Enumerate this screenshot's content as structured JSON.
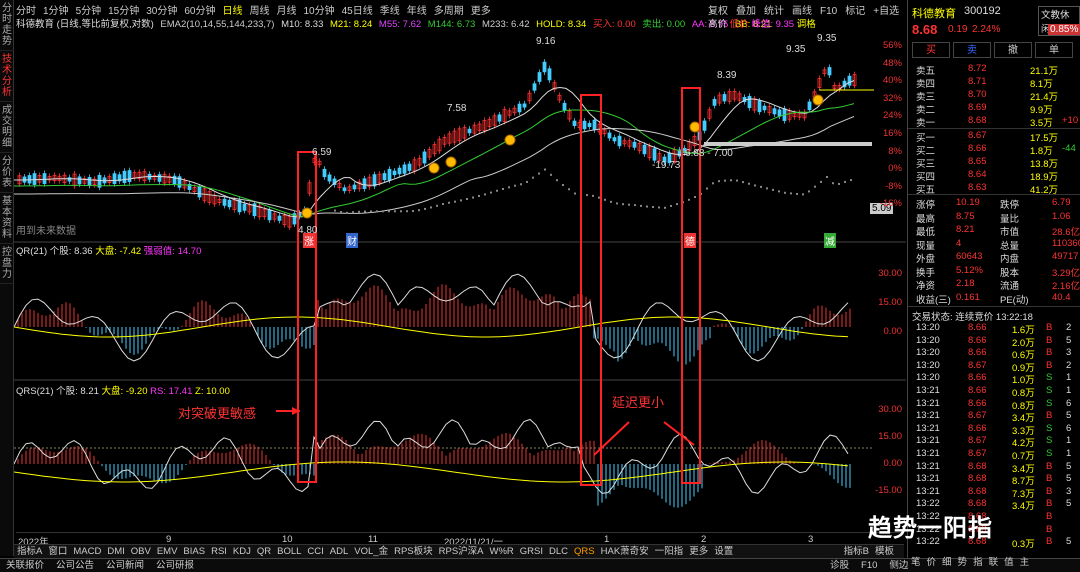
{
  "side_tabs": [
    "分时走势",
    "技术分析",
    "成交明细",
    "分价表",
    "基本资料",
    "控盘力"
  ],
  "side_tabs_active": 1,
  "periods": [
    "分时",
    "1分钟",
    "5分钟",
    "15分钟",
    "30分钟",
    "60分钟",
    "日线",
    "周线",
    "月线",
    "10分钟",
    "45日线",
    "季线",
    "年线",
    "多周期",
    "更多"
  ],
  "period_active": 6,
  "top_right": [
    "复权",
    "叠加",
    "统计",
    "画线",
    "F10",
    "标记",
    "+自选",
    "返回"
  ],
  "info": {
    "stock_title": "科德教育 (日线,等比前复权,对数)",
    "ema": "EMA2(10,14,55,144,233,7)",
    "m10": "M10: 8.33",
    "m21": "M21: 8.24",
    "m55": "M55: 7.62",
    "m144": "M144: 6.73",
    "m233": "M233: 6.42",
    "hold": "HOLD: 8.34",
    "buy": "买入: 0.00",
    "sell": "卖出: 0.00",
    "aa": "AA: 8.75",
    "bb": "BB: 8.21",
    "high": "高价",
    "low": "低价",
    "peak": "峰值: 9.35",
    "trend": "调格"
  },
  "chart_labels": {
    "p916": "9.16",
    "p758": "7.58",
    "p659": "6.59",
    "p839": "8.39",
    "p935a": "9.35",
    "p935b": "9.35",
    "p1973": "-19.73",
    "p688": "6.88 - 7.00",
    "p480": "4.80",
    "future": "用到未来数据",
    "right_price": "5.09"
  },
  "right_axis_main": [
    "56%",
    "48%",
    "40%",
    "32%",
    "24%",
    "16%",
    "8%",
    "0%",
    "-8%",
    "-16%"
  ],
  "ind1": {
    "name": "QR(21)",
    "stock": "个股: 8.36",
    "market": "大盘: -7.42",
    "strong": "强弱值: 14.70",
    "ticks": [
      "30.00",
      "15.00",
      "0.00"
    ]
  },
  "ind2": {
    "name": "QRS(21)",
    "stock": "个股: 8.21",
    "market": "大盘: -9.20",
    "rs": "RS: 17.41",
    "z": "Z: 10.00",
    "ticks": [
      "30.00",
      "15.00",
      "0.00",
      "-15.00"
    ]
  },
  "annotations": {
    "left": "对突破更敏感",
    "right": "延迟更小"
  },
  "markers": {
    "m1": "涨",
    "m2": "财",
    "m3": "德",
    "m4": "减"
  },
  "dates": [
    "2022年",
    "9",
    "10",
    "11",
    "2022/11/21/一",
    "1",
    "2",
    "3"
  ],
  "indicator_tabs": [
    "指标A",
    "窗口",
    "MACD",
    "DMI",
    "OBV",
    "EMV",
    "BIAS",
    "RSI",
    "KDJ",
    "QR",
    "BOLL",
    "CCI",
    "ADL",
    "VOL_金",
    "RPS板块",
    "RPS沪深A",
    "W%R",
    "GRSI",
    "DLC",
    "QRS",
    "HAK萧奇安",
    "一阳指",
    "更多",
    "设置"
  ],
  "indicator_active": "QRS",
  "ind_right": [
    "指标B",
    "模板"
  ],
  "bottom_bar": [
    "关联报价",
    "公司公告",
    "公司新闻",
    "公司研报"
  ],
  "bottom_right": [
    "诊股",
    "F10",
    "侧边"
  ],
  "panel": {
    "name": "科德教育",
    "code": "300192",
    "tag": "文教休闲",
    "price": "8.68",
    "chg": "0.19",
    "pct": "2.24%",
    "pct2": "0.85%",
    "buttons": [
      "买",
      "卖",
      "撤",
      "单"
    ],
    "asks": [
      {
        "l": "卖五",
        "p": "8.72",
        "v": "21.1万"
      },
      {
        "l": "卖四",
        "p": "8.71",
        "v": "8.1万"
      },
      {
        "l": "卖三",
        "p": "8.70",
        "v": "21.4万"
      },
      {
        "l": "卖二",
        "p": "8.69",
        "v": "9.9万"
      },
      {
        "l": "卖一",
        "p": "8.68",
        "v": "3.5万",
        "x": "+10"
      }
    ],
    "bids": [
      {
        "l": "买一",
        "p": "8.67",
        "v": "17.5万"
      },
      {
        "l": "买二",
        "p": "8.66",
        "v": "1.8万",
        "x": "-44"
      },
      {
        "l": "买三",
        "p": "8.65",
        "v": "13.8万"
      },
      {
        "l": "买四",
        "p": "8.64",
        "v": "18.9万"
      },
      {
        "l": "买五",
        "p": "8.63",
        "v": "41.2万"
      }
    ],
    "stats": [
      {
        "a": "涨停",
        "b": "10.19",
        "c": "跌停",
        "d": "6.79"
      },
      {
        "a": "最高",
        "b": "8.75",
        "c": "量比",
        "d": "1.06"
      },
      {
        "a": "最低",
        "b": "8.21",
        "c": "市值",
        "d": "28.6亿"
      },
      {
        "a": "现量",
        "b": "4",
        "c": "总量",
        "d": "110360"
      },
      {
        "a": "外盘",
        "b": "60643",
        "c": "内盘",
        "d": "49717"
      },
      {
        "a": "换手",
        "b": "5.12%",
        "c": "股本",
        "d": "3.29亿"
      },
      {
        "a": "净资",
        "b": "2.18",
        "c": "流通",
        "d": "2.16亿"
      },
      {
        "a": "收益(三)",
        "b": "0.161",
        "c": "PE(动)",
        "d": "40.4"
      }
    ],
    "status": "交易状态: 连续竞价 13:22:18",
    "ticks": [
      {
        "t": "13:20",
        "p": "8.66",
        "v": "1.6万",
        "s": "B",
        "n": "2"
      },
      {
        "t": "13:20",
        "p": "8.66",
        "v": "2.0万",
        "s": "B",
        "n": "5"
      },
      {
        "t": "13:20",
        "p": "8.66",
        "v": "0.6万",
        "s": "B",
        "n": "3"
      },
      {
        "t": "13:20",
        "p": "8.67",
        "v": "0.9万",
        "s": "B",
        "n": "2"
      },
      {
        "t": "13:20",
        "p": "8.66",
        "v": "1.0万",
        "s": "S",
        "n": "1"
      },
      {
        "t": "13:21",
        "p": "8.66",
        "v": "0.8万",
        "s": "S",
        "n": "1"
      },
      {
        "t": "13:21",
        "p": "8.66",
        "v": "0.8万",
        "s": "S",
        "n": "6"
      },
      {
        "t": "13:21",
        "p": "8.67",
        "v": "3.4万",
        "s": "B",
        "n": "5"
      },
      {
        "t": "13:21",
        "p": "8.66",
        "v": "3.3万",
        "s": "S",
        "n": "6"
      },
      {
        "t": "13:21",
        "p": "8.67",
        "v": "4.2万",
        "s": "S",
        "n": "1"
      },
      {
        "t": "13:21",
        "p": "8.67",
        "v": "0.7万",
        "s": "S",
        "n": "1"
      },
      {
        "t": "13:21",
        "p": "8.68",
        "v": "3.4万",
        "s": "B",
        "n": "5"
      },
      {
        "t": "13:21",
        "p": "8.68",
        "v": "8.7万",
        "s": "B",
        "n": "5"
      },
      {
        "t": "13:21",
        "p": "8.68",
        "v": "7.3万",
        "s": "B",
        "n": "3"
      },
      {
        "t": "13:22",
        "p": "8.68",
        "v": "3.4万",
        "s": "B",
        "n": "5"
      },
      {
        "t": "13:22",
        "p": "8.68",
        "v": "",
        "s": "B",
        "n": ""
      },
      {
        "t": "13:22",
        "p": "8.68",
        "v": "",
        "s": "B",
        "n": ""
      },
      {
        "t": "13:22",
        "p": "8.68",
        "v": "0.3万",
        "s": "B",
        "n": "5"
      }
    ],
    "tabs": [
      "笔",
      "价",
      "细",
      "势",
      "指",
      "联",
      "值",
      "主"
    ]
  },
  "watermark": "趋势一阳指"
}
